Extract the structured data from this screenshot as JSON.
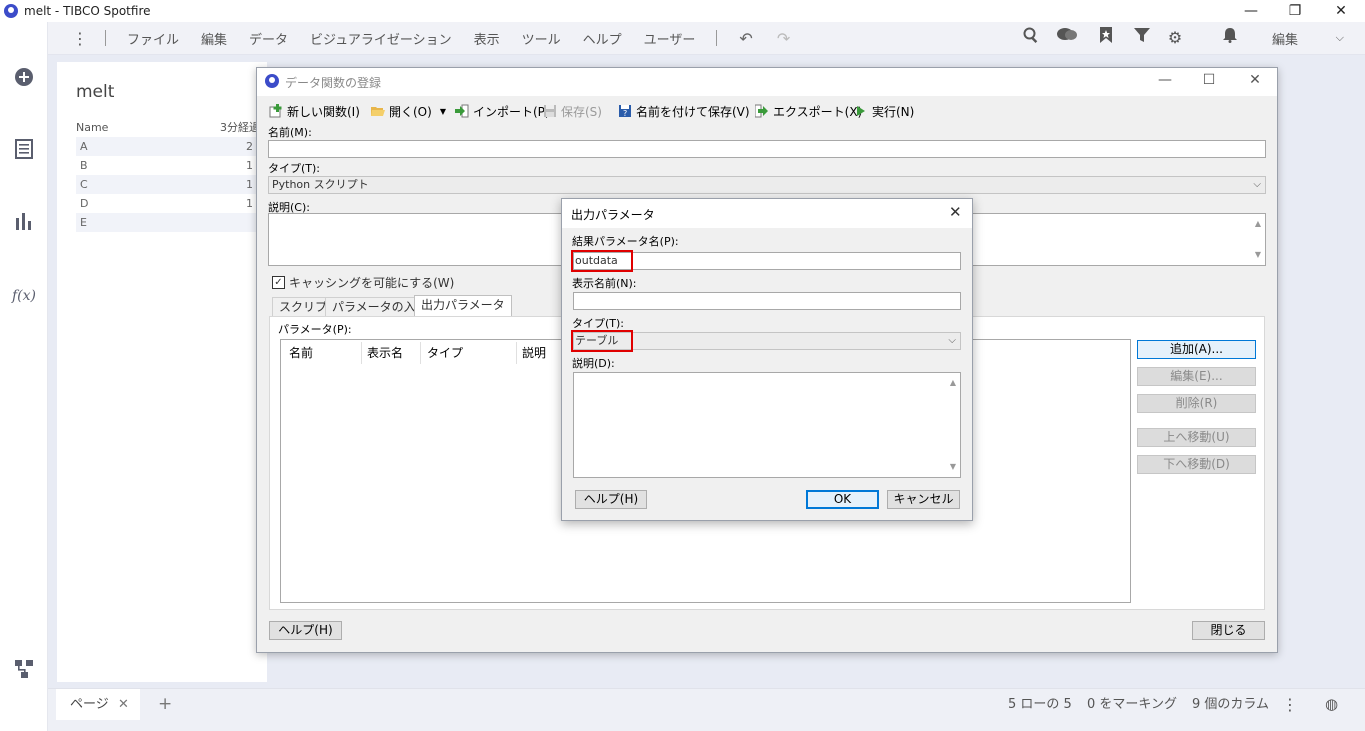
{
  "window": {
    "title": "melt - TIBCO Spotfire"
  },
  "menu": {
    "items": [
      "ファイル",
      "編集",
      "データ",
      "ビジュアライゼーション",
      "表示",
      "ツール",
      "ヘルプ",
      "ユーザー"
    ],
    "mode": "編集"
  },
  "card": {
    "title": "melt",
    "header": {
      "name": "Name",
      "value": "3分経過"
    },
    "rows": [
      {
        "name": "A",
        "value": "2"
      },
      {
        "name": "B",
        "value": "1"
      },
      {
        "name": "C",
        "value": "1"
      },
      {
        "name": "D",
        "value": "1"
      },
      {
        "name": "E",
        "value": ""
      }
    ]
  },
  "pagebar": {
    "tab": "ページ",
    "rows": "5 ローの 5",
    "marking": "0 をマーキング",
    "columns": "9 個のカラム"
  },
  "dialog": {
    "title": "データ関数の登録",
    "toolbar": {
      "new": "新しい関数(I)",
      "open": "開く(O)",
      "import": "インポート(P)",
      "save": "保存(S)",
      "save_as": "名前を付けて保存(V)",
      "export": "エクスポート(X)",
      "run": "実行(N)"
    },
    "name_label": "名前(M):",
    "name_value": "",
    "type_label": "タイプ(T):",
    "type_value": "Python スクリプト",
    "desc_label": "説明(C):",
    "caching": "キャッシングを可能にする(W)",
    "tabs": [
      "スクリプト",
      "パラメータの入力",
      "出力パラメータ"
    ],
    "params_label": "パラメータ(P):",
    "columns": [
      "名前",
      "表示名",
      "タイプ",
      "説明"
    ],
    "buttons": {
      "add": "追加(A)...",
      "edit": "編集(E)...",
      "delete": "削除(R)",
      "up": "上へ移動(U)",
      "down": "下へ移動(D)",
      "help": "ヘルプ(H)",
      "close": "閉じる"
    }
  },
  "output_dialog": {
    "title": "出力パラメータ",
    "result_label": "結果パラメータ名(P):",
    "result_value": "outdata",
    "display_label": "表示名前(N):",
    "display_value": "",
    "type_label": "タイプ(T):",
    "type_value": "テーブル",
    "desc_label": "説明(D):",
    "help": "ヘルプ(H)",
    "ok": "OK",
    "cancel": "キャンセル"
  },
  "colors": {
    "accent": "#3c4cc9",
    "highlight": "#e00000",
    "focus": "#0078d7"
  }
}
